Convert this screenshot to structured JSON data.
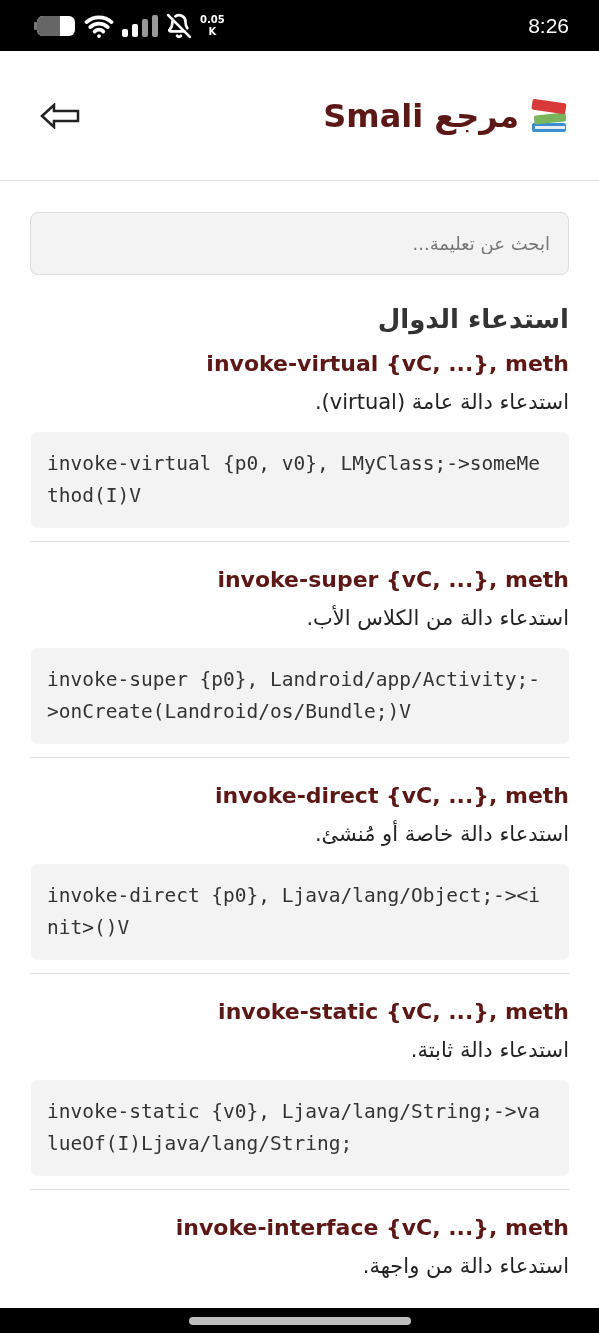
{
  "status_bar": {
    "data_speed": "0.05",
    "data_unit": "K",
    "time": "8:26"
  },
  "header": {
    "title": "مرجع Smali"
  },
  "search": {
    "placeholder": "ابحث عن تعليمة..."
  },
  "section": {
    "heading": "استدعاء الدوال",
    "entries": [
      {
        "title": "invoke-virtual {vC, ...}, meth",
        "description": "استدعاء دالة عامة (virtual).",
        "code": "invoke-virtual {p0, v0}, LMyClass;->someMethod(I)V"
      },
      {
        "title": "invoke-super {vC, ...}, meth",
        "description": "استدعاء دالة من الكلاس الأب.",
        "code": "invoke-super {p0}, Landroid/app/Activity;->onCreate(Landroid/os/Bundle;)V"
      },
      {
        "title": "invoke-direct {vC, ...}, meth",
        "description": "استدعاء دالة خاصة أو مُنشئ.",
        "code": "invoke-direct {p0}, Ljava/lang/Object;-><init>()V"
      },
      {
        "title": "invoke-static {vC, ...}, meth",
        "description": "استدعاء دالة ثابتة.",
        "code": "invoke-static {v0}, Ljava/lang/String;->valueOf(I)Ljava/lang/String;"
      },
      {
        "title": "invoke-interface {vC, ...}, meth",
        "description": "استدعاء دالة من واجهة."
      }
    ]
  }
}
